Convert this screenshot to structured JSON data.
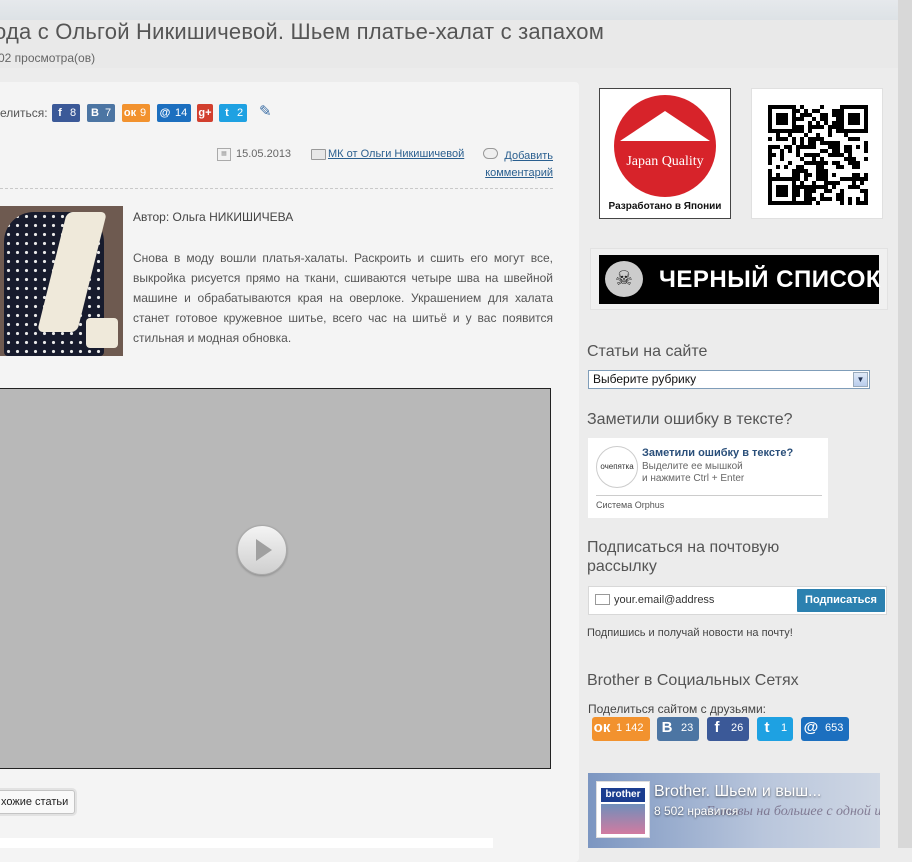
{
  "header": {
    "title": "ода с Ольгой Никишичевой. Шьем платье-халат с запахом",
    "views": "02 просмотра(ов)"
  },
  "share": {
    "label": "елиться:",
    "buttons": [
      {
        "icon": "f",
        "count": "8",
        "color": "#3b5998"
      },
      {
        "icon": "В",
        "count": "7",
        "color": "#4c75a3"
      },
      {
        "icon": "ок",
        "count": "9",
        "color": "#f2922e"
      },
      {
        "icon": "@",
        "count": "14",
        "color": "#1c6fbf"
      },
      {
        "icon": "g+",
        "count": "",
        "color": "#d23f2e"
      },
      {
        "icon": "t",
        "count": "2",
        "color": "#1ea1e2"
      }
    ]
  },
  "meta": {
    "date": "15.05.2013",
    "category": "МК от Ольги Никишичевой",
    "comment_link": "Добавить комментарий"
  },
  "article": {
    "author": "Автор: Ольга НИКИШИЧЕВА",
    "intro": "Снова в моду вошли платья-халаты. Раскроить и сшить его могут все, выкройка рисуется прямо на ткани, сшиваются четыре шва на швейной машине и обрабатываются края на оверлоке. Украшением для халата станет готовое кружевное шитье, всего час на шитьё и у вас появится стильная и модная обновка.",
    "similar_button": "хожие статьи"
  },
  "sidebar": {
    "japan": {
      "title": "Japan Quality",
      "caption": "Разработано в Японии"
    },
    "blacklist": "ЧЕРНЫЙ СПИСОК",
    "categories_title": "Статьи на сайте",
    "categories_select": "Выберите рубрику",
    "orphus_title": "Заметили ошибку в тексте?",
    "orphus": {
      "logo": "очепятка",
      "heading": "Заметили ошибку в тексте?",
      "line1": "Выделите ее мышкой",
      "line2": "и нажмите Ctrl + Enter",
      "footer": "Система Orphus"
    },
    "subscribe_title": "Подписаться на почтовую рассылку",
    "subscribe_placeholder": "your.email@address",
    "subscribe_button": "Подписаться",
    "subscribe_note": "Подпишись и получай новости на почту!",
    "social_title": "Brother в Социальных Сетях",
    "share_site_label": "Поделиться сайтом с друзьями:",
    "social_buttons": [
      {
        "icon": "ок",
        "count": "1 142",
        "color": "#f2922e"
      },
      {
        "icon": "В",
        "count": "23",
        "color": "#4c75a3"
      },
      {
        "icon": "f",
        "count": "26",
        "color": "#3b5998"
      },
      {
        "icon": "t",
        "count": "1",
        "color": "#1ea1e2"
      },
      {
        "icon": "@",
        "count": "653",
        "color": "#1c6fbf"
      }
    ],
    "fb_widget": {
      "logo": "brother",
      "page_name": "Brother. Шьем и выш...",
      "likes": "8 502 нравится",
      "background_text": "Готовы на большее с одной иглой?"
    }
  }
}
